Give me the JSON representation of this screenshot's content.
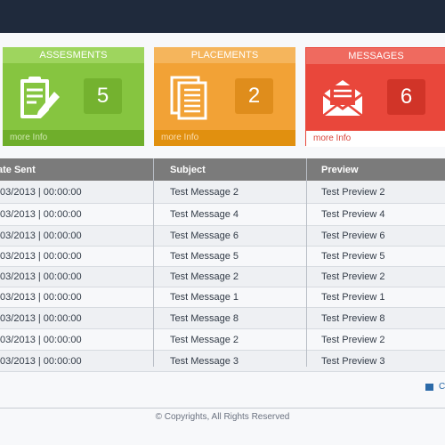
{
  "cards": [
    {
      "title": "ASSESMENTS",
      "count": "5",
      "footer": "more Info",
      "icon": "clipboard-pencil-icon"
    },
    {
      "title": "PLACEMENTS",
      "count": "2",
      "footer": "more Info",
      "icon": "documents-icon"
    },
    {
      "title": "MESSAGES",
      "count": "6",
      "footer": "more Info",
      "icon": "open-envelope-icon"
    }
  ],
  "colors": {
    "topbar": "#1f2a3c",
    "assessments": "#86c540",
    "placements": "#f2a236",
    "messages": "#e9473b",
    "table_header": "#7b7b7b"
  },
  "table": {
    "headers": [
      "ate Sent",
      "Subject",
      "Preview"
    ],
    "rows": [
      [
        "/03/2013 | 00:00:00",
        "Test Message 2",
        "Test Preview 2"
      ],
      [
        "/03/2013 | 00:00:00",
        "Test Message 4",
        "Test Preview 4"
      ],
      [
        "/03/2013 | 00:00:00",
        "Test Message 6",
        "Test Preview 6"
      ],
      [
        "/03/2013 | 00:00:00",
        "Test Message 5",
        "Test Preview 5"
      ],
      [
        "/03/2013 | 00:00:00",
        "Test Message 2",
        "Test Preview 2"
      ],
      [
        "/03/2013 | 00:00:00",
        "Test Message 1",
        "Test Preview 1"
      ],
      [
        "/03/2013 | 00:00:00",
        "Test Message 8",
        "Test Preview 8"
      ],
      [
        "/03/2013 | 00:00:00",
        "Test Message 2",
        "Test Preview 2"
      ],
      [
        "/03/2013 | 00:00:00",
        "Test Message 3",
        "Test Preview 3"
      ]
    ]
  },
  "corner_link": {
    "label": "C",
    "icon": "square-icon"
  },
  "footer": {
    "copyright": "© Copyrights, All Rights Reserved"
  }
}
